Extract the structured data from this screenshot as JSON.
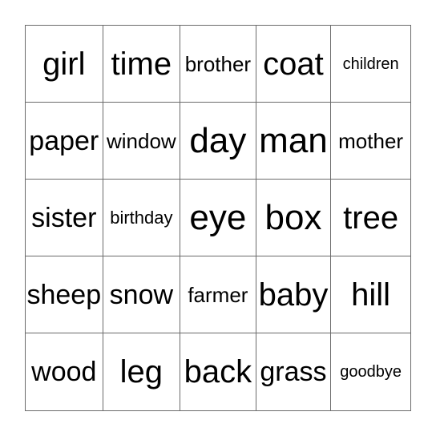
{
  "card": {
    "type": "bingo-card",
    "columns": 5,
    "rows": 5,
    "background_color": "#ffffff",
    "border_color": "#6b6b6b",
    "text_color": "#000000",
    "cells": [
      [
        {
          "word": "girl",
          "size": "lg"
        },
        {
          "word": "time",
          "size": "lg"
        },
        {
          "word": "brother",
          "size": "sm"
        },
        {
          "word": "coat",
          "size": "lg"
        },
        {
          "word": "children",
          "size": "xxs"
        }
      ],
      [
        {
          "word": "paper",
          "size": "md"
        },
        {
          "word": "window",
          "size": "sm"
        },
        {
          "word": "day",
          "size": "xl"
        },
        {
          "word": "man",
          "size": "xl"
        },
        {
          "word": "mother",
          "size": "sm"
        }
      ],
      [
        {
          "word": "sister",
          "size": "md"
        },
        {
          "word": "birthday",
          "size": "xs"
        },
        {
          "word": "eye",
          "size": "xl"
        },
        {
          "word": "box",
          "size": "xl"
        },
        {
          "word": "tree",
          "size": "lg"
        }
      ],
      [
        {
          "word": "sheep",
          "size": "md"
        },
        {
          "word": "snow",
          "size": "md"
        },
        {
          "word": "farmer",
          "size": "sm"
        },
        {
          "word": "baby",
          "size": "lg"
        },
        {
          "word": "hill",
          "size": "lg"
        }
      ],
      [
        {
          "word": "wood",
          "size": "md"
        },
        {
          "word": "leg",
          "size": "lg"
        },
        {
          "word": "back",
          "size": "lg"
        },
        {
          "word": "grass",
          "size": "md"
        },
        {
          "word": "goodbye",
          "size": "xxs"
        }
      ]
    ]
  }
}
